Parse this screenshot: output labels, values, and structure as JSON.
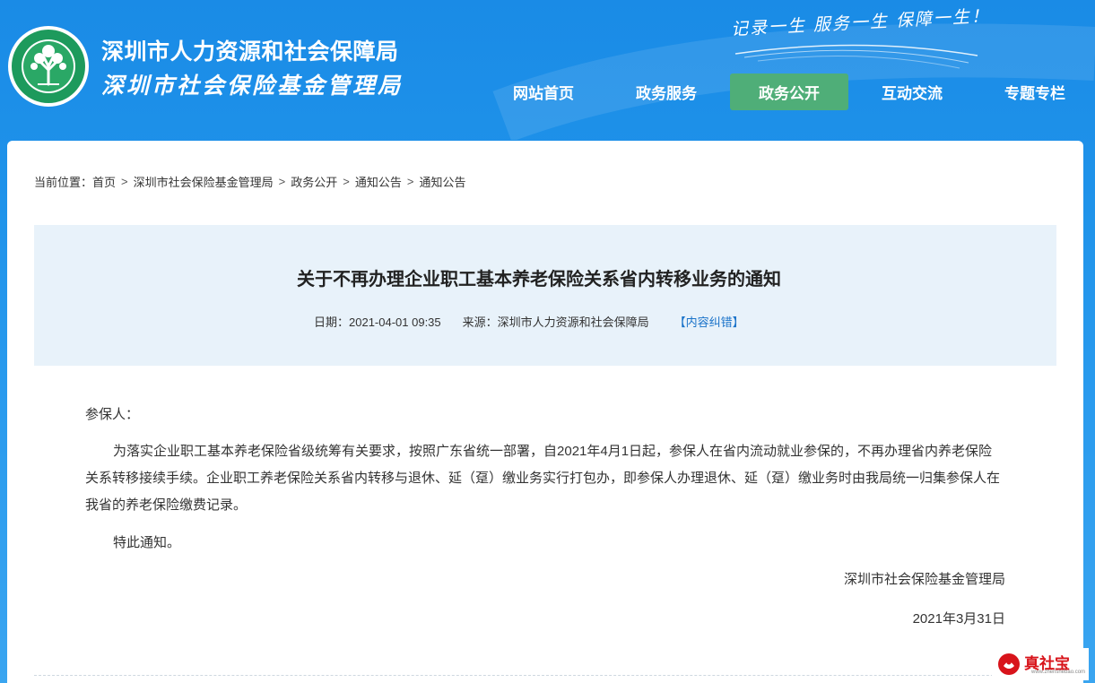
{
  "header": {
    "site_name_primary": "深圳市人力资源和社会保障局",
    "site_name_secondary": "深圳市社会保险基金管理局",
    "slogan": "记录一生  服务一生  保障一生！",
    "nav": [
      {
        "label": "网站首页",
        "active": false
      },
      {
        "label": "政务服务",
        "active": false
      },
      {
        "label": "政务公开",
        "active": true
      },
      {
        "label": "互动交流",
        "active": false
      },
      {
        "label": "专题专栏",
        "active": false
      }
    ]
  },
  "breadcrumb": {
    "prefix": "当前位置：",
    "items": [
      "首页",
      "深圳市社会保险基金管理局",
      "政务公开",
      "通知公告",
      "通知公告"
    ],
    "separator": ">"
  },
  "article": {
    "title": "关于不再办理企业职工基本养老保险关系省内转移业务的通知",
    "date": "日期：2021-04-01 09:35",
    "source": "来源：深圳市人力资源和社会保障局",
    "report_link": "【内容纠错】",
    "greeting": "参保人：",
    "paragraph": "为落实企业职工基本养老保险省级统筹有关要求，按照广东省统一部署，自2021年4月1日起，参保人在省内流动就业参保的，不再办理省内养老保险关系转移接续手续。企业职工养老保险关系省内转移与退休、延（趸）缴业务实行打包办，即参保人办理退休、延（趸）缴业务时由我局统一归集参保人在我省的养老保险缴费记录。",
    "closing": "特此通知。",
    "signature": "深圳市社会保险基金管理局",
    "sign_date": "2021年3月31日"
  },
  "watermark": {
    "text": "真社宝",
    "subtext": "www.zhenshebao.com"
  },
  "colors": {
    "header_blue": "#1f93ea",
    "nav_active": "#4fae78",
    "title_box": "#e8f2fa",
    "link_blue": "#1a73c9",
    "watermark_red": "#d8141b"
  }
}
